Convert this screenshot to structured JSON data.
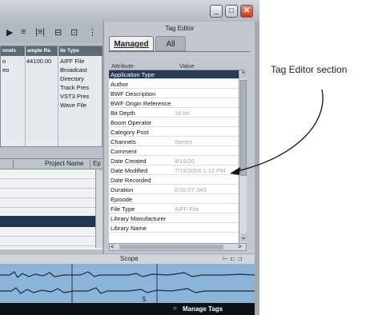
{
  "window": {
    "minimize_glyph": "_",
    "maximize_glyph": "□",
    "close_glyph": "✕"
  },
  "toolbar": {
    "icons": [
      "▶",
      "≡",
      "|≡|",
      "⊟",
      "⊡",
      "⋮"
    ]
  },
  "file_grid": {
    "headers": [
      "nnels",
      "ample Ra",
      "ile Type"
    ],
    "rows": [
      [
        "o",
        "44100.00",
        "AIFF File"
      ],
      [
        "eo",
        "",
        "Broadcast"
      ],
      [
        "",
        "",
        "Directory"
      ],
      [
        "",
        "",
        "Track Pres"
      ],
      [
        "",
        "",
        "VST3 Pres"
      ],
      [
        "",
        "",
        "Wave File"
      ]
    ]
  },
  "project_panel": {
    "column_project_name": "Project Name",
    "column_ep": "Ep"
  },
  "tag_editor": {
    "title": "Tag Editor",
    "tabs": [
      "Managed",
      "All"
    ],
    "col_attribute": "Attribute",
    "col_value": "Value",
    "rows": [
      {
        "attribute": "Application Type",
        "value": ""
      },
      {
        "attribute": "Author",
        "value": ""
      },
      {
        "attribute": "BWF Description",
        "value": ""
      },
      {
        "attribute": "BWF Origin Reference",
        "value": ""
      },
      {
        "attribute": "Bit Depth",
        "value": "16 bit"
      },
      {
        "attribute": "Boom Operator",
        "value": ""
      },
      {
        "attribute": "Category Post",
        "value": ""
      },
      {
        "attribute": "Channels",
        "value": "Stereo"
      },
      {
        "attribute": "Comment",
        "value": ""
      },
      {
        "attribute": "Date Created",
        "value": "8/16/20"
      },
      {
        "attribute": "Date Modified",
        "value": "7/19/2006 1:12 PM"
      },
      {
        "attribute": "Date Recorded",
        "value": ""
      },
      {
        "attribute": "Duration",
        "value": "0:00:07.343"
      },
      {
        "attribute": "Episode",
        "value": ""
      },
      {
        "attribute": "File Type",
        "value": "AIFF File"
      },
      {
        "attribute": "Library Manufacturer",
        "value": ""
      },
      {
        "attribute": "Library Name",
        "value": ""
      }
    ],
    "selected_index": 0,
    "scroll_up": "^",
    "scroll_down": "⌄",
    "scroll_left": "<",
    "scroll_right": ">"
  },
  "scope": {
    "title": "Scope",
    "controls": "⊢ ⊏ ⊐",
    "marker": "5"
  },
  "status": {
    "manage_tags": "Manage Tags",
    "manage_glyph": "○"
  },
  "annotation": {
    "label": "Tag Editor section"
  }
}
